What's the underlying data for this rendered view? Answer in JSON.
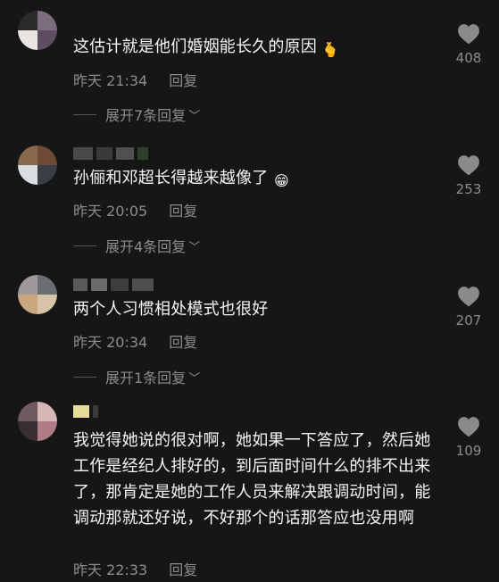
{
  "comments": [
    {
      "text": "这估计就是他们婚姻能长久的原因",
      "emoji": "🫰",
      "time": "昨天 21:34",
      "reply_label": "回复",
      "expand_label": "展开7条回复",
      "likes": "408",
      "avatar_colors": [
        "#2a2a2a",
        "#7a6e7e",
        "#e8e4e0",
        "#5e4c63"
      ]
    },
    {
      "text": "孙俪和邓超长得越来越像了",
      "emoji": "😁",
      "time": "昨天 20:05",
      "reply_label": "回复",
      "expand_label": "展开4条回复",
      "likes": "253",
      "avatar_colors": [
        "#8a6a4f",
        "#6f4a36",
        "#d9dfe0",
        "#3a3f45"
      ]
    },
    {
      "text": "两个人习惯相处模式也很好",
      "time": "昨天 20:34",
      "reply_label": "回复",
      "expand_label": "展开1条回复",
      "likes": "207",
      "avatar_colors": [
        "#9f9a99",
        "#6b6e70",
        "#c9a680",
        "#d7c3a7"
      ]
    },
    {
      "text": "我觉得她说的很对啊，她如果一下答应了，然后她工作是经纪人排好的，到后面时间什么的排不出来了，那肯定是她的工作人员来解决跟调动时间，能调动那就还好说，不好那个的话那答应也没用啊",
      "time": "昨天 22:33",
      "reply_label": "回复",
      "likes": "109",
      "avatar_colors": [
        "#6f5a62",
        "#d7b6b8",
        "#3a2e34",
        "#b07d86"
      ]
    }
  ],
  "colors": {
    "background": "#161616",
    "text": "#f5f5f5",
    "meta": "#8c8c8c",
    "heart": "#8a8a8a"
  }
}
